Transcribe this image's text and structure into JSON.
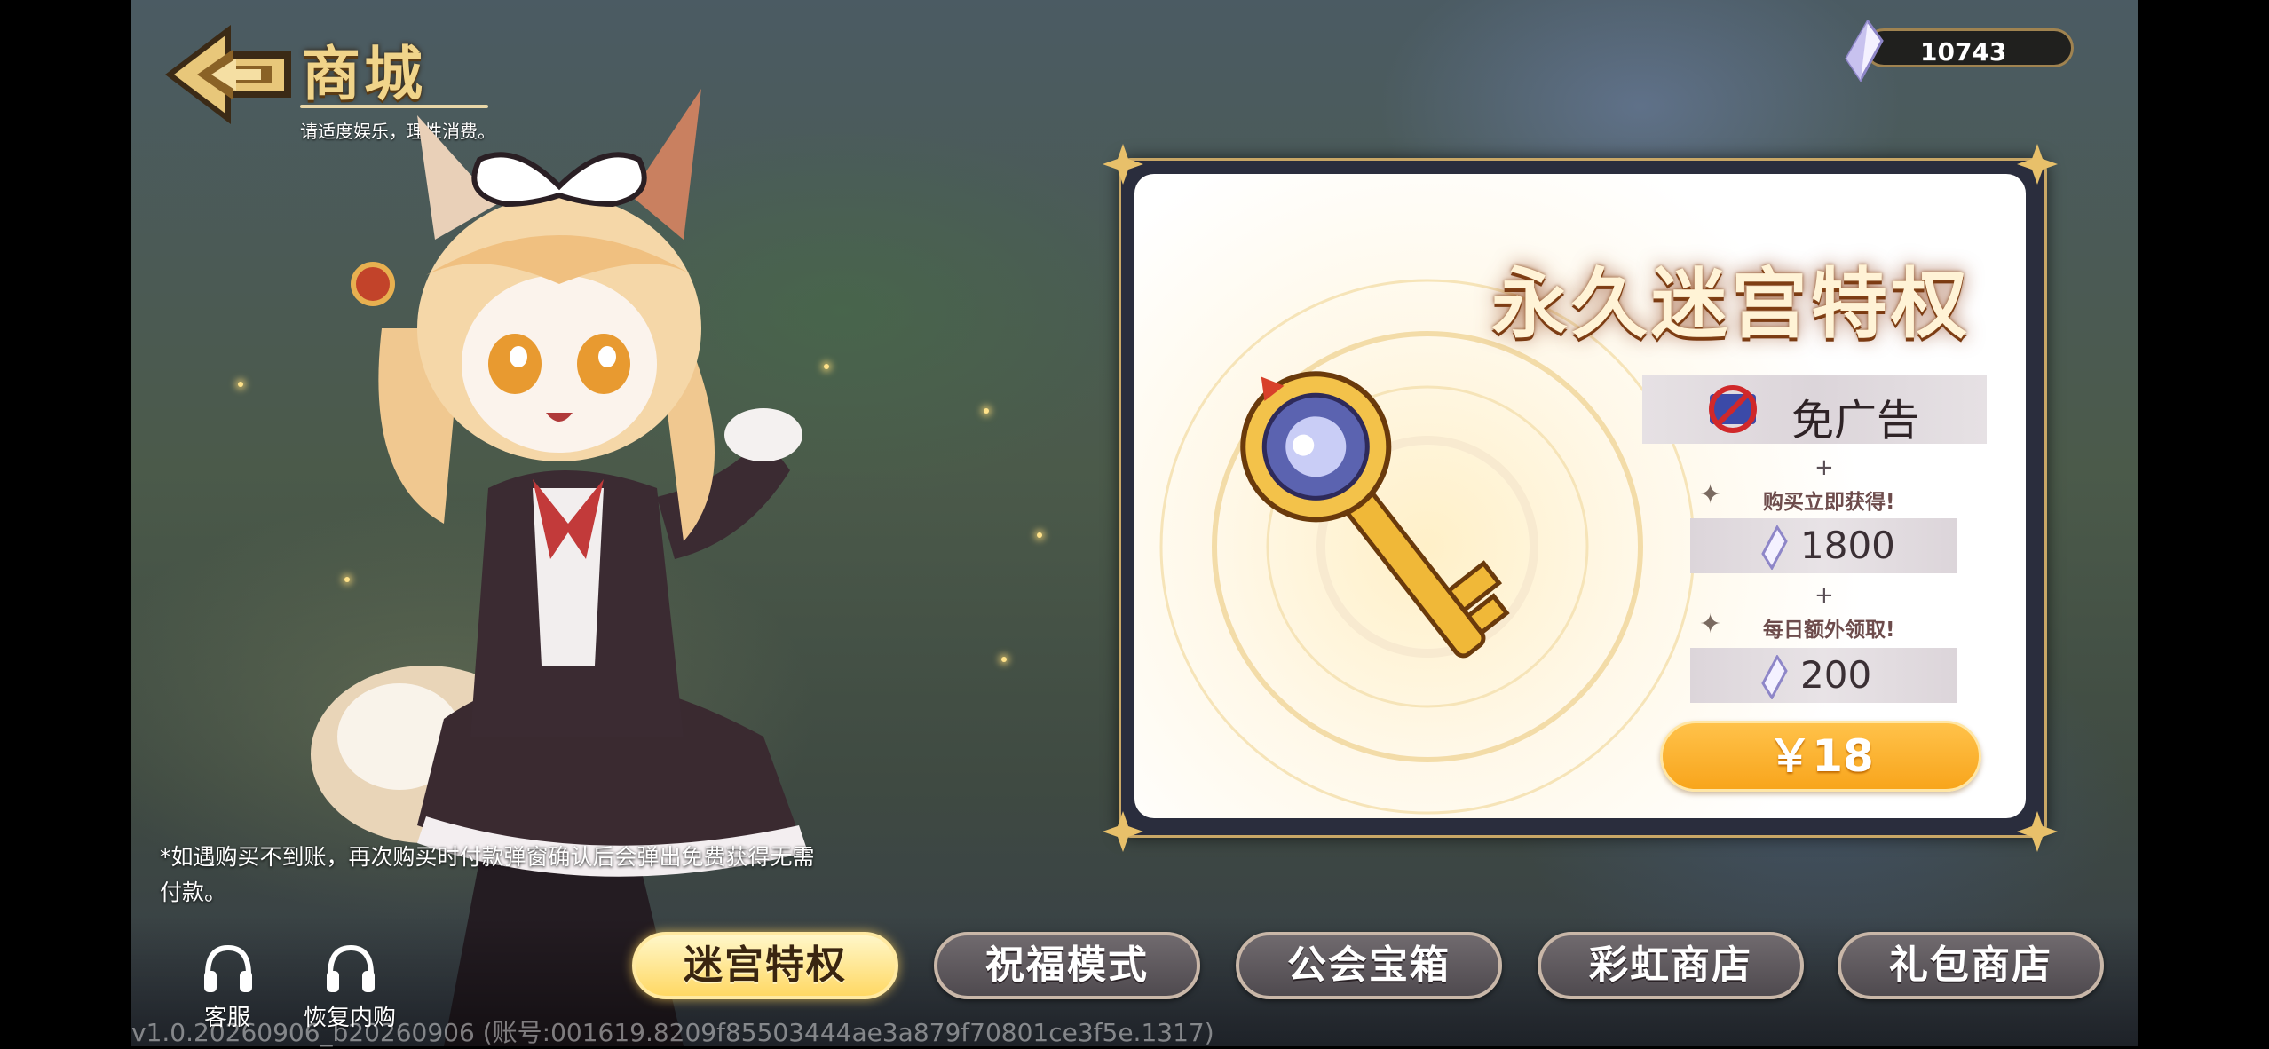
{
  "header": {
    "title": "商城",
    "subtitle": "请适度娱乐，理性消费。"
  },
  "currency": {
    "value": "10743",
    "icon": "crystal-icon"
  },
  "card": {
    "title": "永久迷宫特权",
    "item_icon": "golden-key-icon",
    "benefit": {
      "icon": "no-ads-icon",
      "label": "免广告"
    },
    "plus_1": "+",
    "plus_2": "+",
    "instant": {
      "caption": "购买立即获得!",
      "amount": "1800"
    },
    "daily": {
      "caption": "每日额外领取!",
      "amount": "200"
    },
    "price": "￥18"
  },
  "note": "*如遇购买不到账，再次购买时付款弹窗确认后会弹出免费获得无需付款。",
  "side_buttons": [
    {
      "label": "客服",
      "icon": "headset-icon"
    },
    {
      "label": "恢复内购",
      "icon": "headset-icon"
    }
  ],
  "tabs": [
    {
      "label": "迷宫特权",
      "active": true
    },
    {
      "label": "祝福模式",
      "active": false
    },
    {
      "label": "公会宝箱",
      "active": false
    },
    {
      "label": "彩虹商店",
      "active": false
    },
    {
      "label": "礼包商店",
      "active": false
    }
  ],
  "version": "v1.0.20260906_b20260906 (账号:001619.8209f85503444ae3a879f70801ce3f5e.1317)",
  "colors": {
    "accent_gold": "#f8a51c",
    "frame_gold": "#c9a766",
    "tab_active": "#ffd864"
  }
}
